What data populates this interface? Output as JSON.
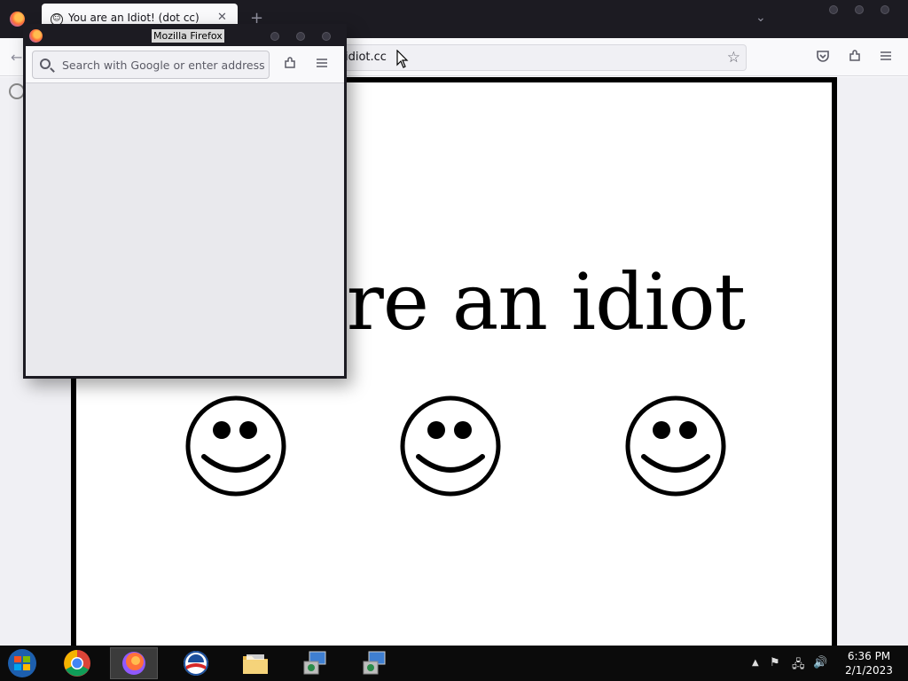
{
  "main_window": {
    "tab": {
      "title": "You are an Idiot! (dot cc)",
      "favicon": "smiley-icon"
    },
    "url": "idiot.cc",
    "page": {
      "headline": "are an idiot",
      "smiley_count": 3
    }
  },
  "popup": {
    "title": "Mozilla Firefox",
    "search_placeholder": "Search with Google or enter address"
  },
  "taskbar": {
    "apps": [
      "windows-orb-icon",
      "chrome-icon",
      "firefox-icon",
      "obama-logo-icon",
      "file-explorer-icon",
      "installer-icon",
      "installer-icon"
    ],
    "clock": {
      "time": "6:36 PM",
      "date": "2/1/2023"
    }
  }
}
